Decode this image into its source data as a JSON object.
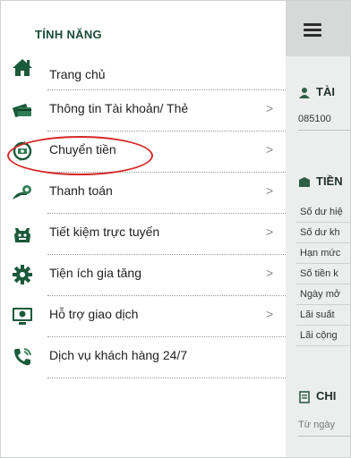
{
  "drawer": {
    "title": "TÍNH NĂNG",
    "items": [
      {
        "label": "Trang chủ",
        "icon": "home-icon",
        "chevron": ""
      },
      {
        "label": "Thông tin Tài khoản/ Thẻ",
        "icon": "account-card-icon",
        "chevron": ">"
      },
      {
        "label": "Chuyển tiền",
        "icon": "money-transfer-icon",
        "chevron": ">"
      },
      {
        "label": "Thanh toán",
        "icon": "payment-icon",
        "chevron": ">"
      },
      {
        "label": "Tiết kiệm trực tuyến",
        "icon": "piggy-bank-icon",
        "chevron": ">"
      },
      {
        "label": "Tiện ích gia tăng",
        "icon": "gear-icon",
        "chevron": ">"
      },
      {
        "label": "Hỗ trợ giao dịch",
        "icon": "support-monitor-icon",
        "chevron": ">"
      },
      {
        "label": "Dịch vụ khách hàng 24/7",
        "icon": "phone-icon",
        "chevron": ""
      }
    ]
  },
  "panel": {
    "menu_icon": "hamburger-icon",
    "account_section": "TÀI",
    "account_number": "085100",
    "savings_section": "TIỀN",
    "rows": [
      "Số dư hiệ",
      "Số dư kh",
      "Hạn mức",
      "Số tiền k",
      "Ngày mở",
      "Lãi suất",
      "Lãi cộng"
    ],
    "detail_section": "CHI",
    "from_date_placeholder": "Từ ngày"
  },
  "colors": {
    "brand_green": "#1a4f35",
    "highlight_red": "#d62828",
    "panel_bg": "#eceeed"
  }
}
